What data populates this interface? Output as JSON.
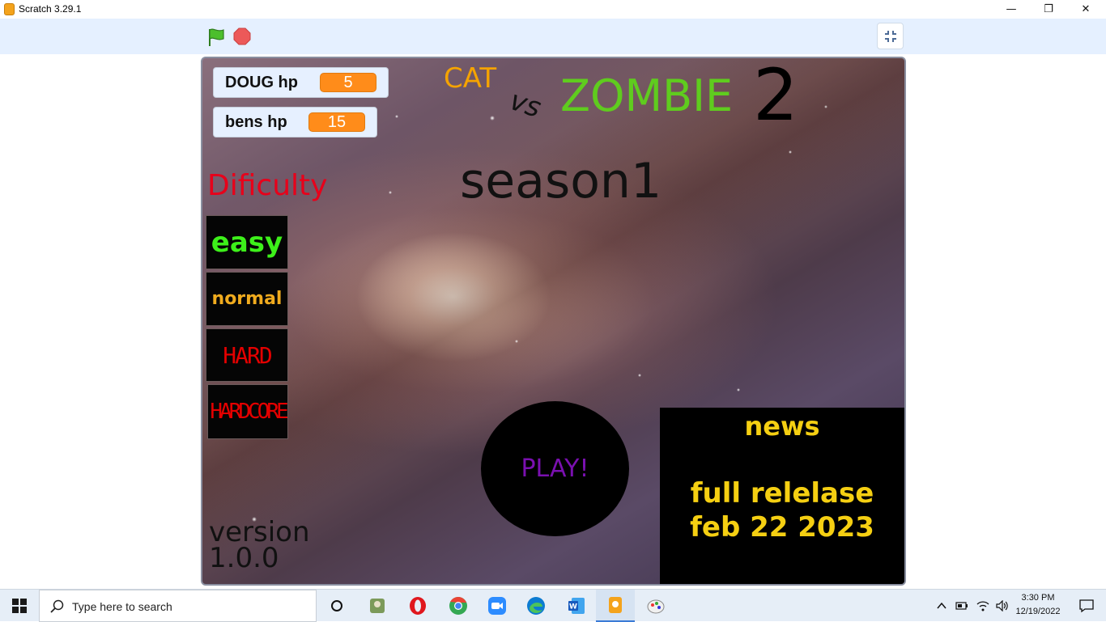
{
  "window": {
    "title": "Scratch 3.29.1",
    "controls": {
      "minimize": "—",
      "restore": "❐",
      "close": "✕"
    }
  },
  "toolbar": {
    "green_flag_icon": "green-flag-icon",
    "stop_icon": "stop-icon",
    "fullscreen_icon": "unfullscreen-icon"
  },
  "stage": {
    "monitors": [
      {
        "label": "DOUG hp",
        "value": "5"
      },
      {
        "label": "bens hp",
        "value": "15"
      }
    ],
    "title": {
      "cat": "CAT",
      "vs": "vs",
      "zombie": "ZOMBIE",
      "number": "2"
    },
    "season": "season1",
    "difficulty_label": "Dificulty",
    "difficulty_buttons": [
      "easy",
      "normal",
      "HARD",
      "HARDCORE"
    ],
    "play_button": "PLAY!",
    "news": {
      "title": "news",
      "line1": "full relelase",
      "line2": "feb 22 2023"
    },
    "version": "version 1.0.0",
    "colors": {
      "cat": "#f5a300",
      "zombie": "#5fcc1e",
      "difficulty": "#e8001a",
      "easy": "#3df01a",
      "normal": "#f0ab1e",
      "hard": "#e40000",
      "play": "#7a10b0",
      "news": "#f5cf12",
      "monitor_value": "#ff8c1a"
    }
  },
  "taskbar": {
    "search_placeholder": "Type here to search",
    "time": "3:30 PM",
    "date": "12/19/2022",
    "apps": [
      "task-view-icon",
      "game-app-icon",
      "opera-icon",
      "chrome-icon",
      "zoom-icon",
      "edge-icon",
      "word-icon",
      "scratch-icon",
      "paint-icon"
    ]
  }
}
